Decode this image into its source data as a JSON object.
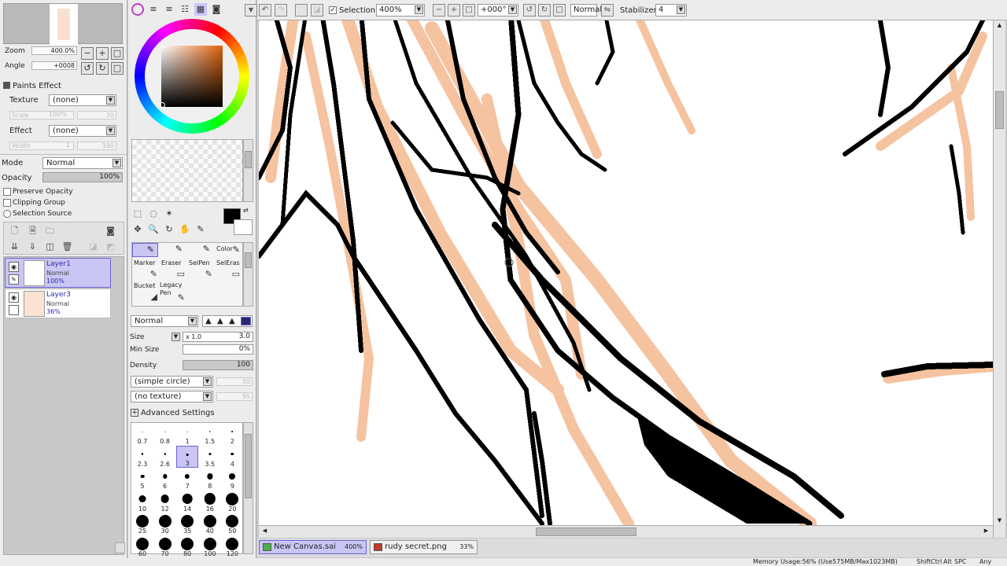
{
  "navigator": {
    "zoom_label": "Zoom",
    "zoom_value": "400.0%",
    "angle_label": "Angle",
    "angle_value": "+0008"
  },
  "paints_effect": {
    "header": "Paints Effect",
    "texture_label": "Texture",
    "texture_value": "(none)",
    "scale_label": "Scale",
    "scale_value": "100%",
    "scale_num": "20",
    "effect_label": "Effect",
    "effect_value": "(none)",
    "width_label": "Width",
    "width_value": "1",
    "width_num": "100"
  },
  "layer_props": {
    "mode_label": "Mode",
    "mode_value": "Normal",
    "opacity_label": "Opacity",
    "opacity_value": "100%",
    "opacity_fraction": 1.0,
    "preserve_opacity": "Preserve Opacity",
    "clipping_group": "Clipping Group",
    "selection_source": "Selection Source"
  },
  "layers": [
    {
      "name": "Layer1",
      "mode": "Normal",
      "opacity": "100%",
      "active": true
    },
    {
      "name": "Layer3",
      "mode": "Normal",
      "opacity": "36%",
      "active": false
    }
  ],
  "tools": {
    "cells": [
      {
        "label": "Marker",
        "icon": "✎"
      },
      {
        "label": "Eraser",
        "icon": "▭"
      },
      {
        "label": "SelPen",
        "icon": "✎"
      },
      {
        "label": "SelEras",
        "icon": "▭"
      },
      {
        "label": "Bucket",
        "icon": "◢"
      },
      {
        "label": "Legacy Pen",
        "icon": "✎"
      }
    ],
    "color_tab": "Color"
  },
  "brush": {
    "blend_mode": "Normal",
    "size_label": "Size",
    "size_mult": "x 1.0",
    "size_value": "3.0",
    "min_size_label": "Min Size",
    "min_size_value": "0%",
    "density_label": "Density",
    "density_value": "100",
    "density_fraction": 1.0,
    "shape": "(simple circle)",
    "shape_num": "50",
    "texture": "(no texture)",
    "texture_num": "95",
    "advanced": "Advanced Settings",
    "sizes": [
      "0.7",
      "0.8",
      "1",
      "1.5",
      "2",
      "2.3",
      "2.6",
      "3",
      "3.5",
      "4",
      "5",
      "6",
      "7",
      "8",
      "9",
      "10",
      "12",
      "14",
      "16",
      "20",
      "25",
      "30",
      "35",
      "40",
      "50",
      "60",
      "70",
      "80",
      "100",
      "120"
    ],
    "selected_size": "3"
  },
  "toolbar": {
    "selection_label": "Selection",
    "zoom": "400%",
    "angle": "+000°",
    "blend": "Normal",
    "stabilizer_label": "Stabilizer",
    "stabilizer_value": "4"
  },
  "tabs": [
    {
      "name": "New Canvas.sai",
      "percent": "400%",
      "active": true
    },
    {
      "name": "rudy secret.png",
      "percent": "33%",
      "active": false
    }
  ],
  "status": {
    "memory": "Memory Usage:56% (Use575MB/Max1023MB)",
    "keys": [
      "Shift",
      "Ctrl",
      "Alt",
      "SPC",
      "Any"
    ]
  },
  "colors": {
    "accent": "#c9c6f5",
    "accent_border": "#6b63d8",
    "skin": "#f5c3a0",
    "line": "#000000"
  }
}
